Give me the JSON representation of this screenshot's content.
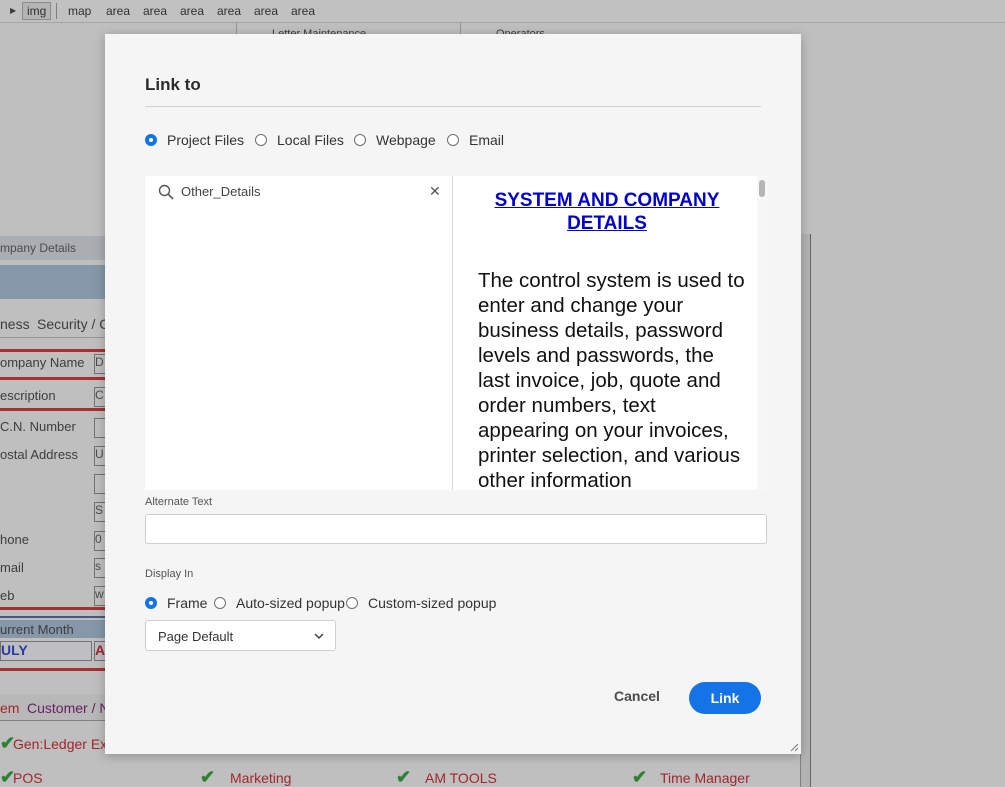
{
  "background": {
    "tagbar": [
      "img",
      "map",
      "area",
      "area",
      "area",
      "area",
      "area",
      "area"
    ],
    "top_labels": [
      "Letter Maintenance",
      "Operators"
    ],
    "window_title": "mpany Details",
    "tabs": [
      "ness",
      "Security / C"
    ],
    "fields": [
      "ompany Name",
      "escription",
      "C.N. Number",
      "ostal Address",
      "hone",
      "mail",
      "eb"
    ],
    "field_values": [
      "D",
      "C",
      "",
      "U",
      "",
      "S",
      "0",
      "s",
      "w"
    ],
    "current_month_label": "urrent Month",
    "month_value": "ULY",
    "month_value2": "A",
    "bottom_tabs": [
      "em",
      "Customer / N"
    ],
    "modules": [
      "Gen:Ledger Ex",
      "POS",
      "Marketing",
      "AM TOOLS",
      "Time Manager"
    ]
  },
  "dialog": {
    "title": "Link to",
    "link_types": [
      {
        "label": "Project Files",
        "selected": true
      },
      {
        "label": "Local Files",
        "selected": false
      },
      {
        "label": "Webpage",
        "selected": false
      },
      {
        "label": "Email",
        "selected": false
      }
    ],
    "search": {
      "value": "Other_Details",
      "icon": "search-icon",
      "clear_icon": "close-icon"
    },
    "preview": {
      "title": "SYSTEM AND COMPANY DETAILS",
      "body": "The control system is used to enter and change your business details, password levels and passwords, the last invoice, job, quote and order numbers, text appearing on your invoices, printer selection, and various other information"
    },
    "alt_text_label": "Alternate Text",
    "alt_text_value": "",
    "display_in_label": "Display In",
    "display_options": [
      {
        "label": "Frame",
        "selected": true
      },
      {
        "label": "Auto-sized popup",
        "selected": false
      },
      {
        "label": "Custom-sized popup",
        "selected": false
      }
    ],
    "size_select": {
      "value": "Page Default",
      "icon": "chevron-down-icon"
    },
    "cancel_label": "Cancel",
    "link_label": "Link",
    "accent_color": "#1473e6"
  }
}
